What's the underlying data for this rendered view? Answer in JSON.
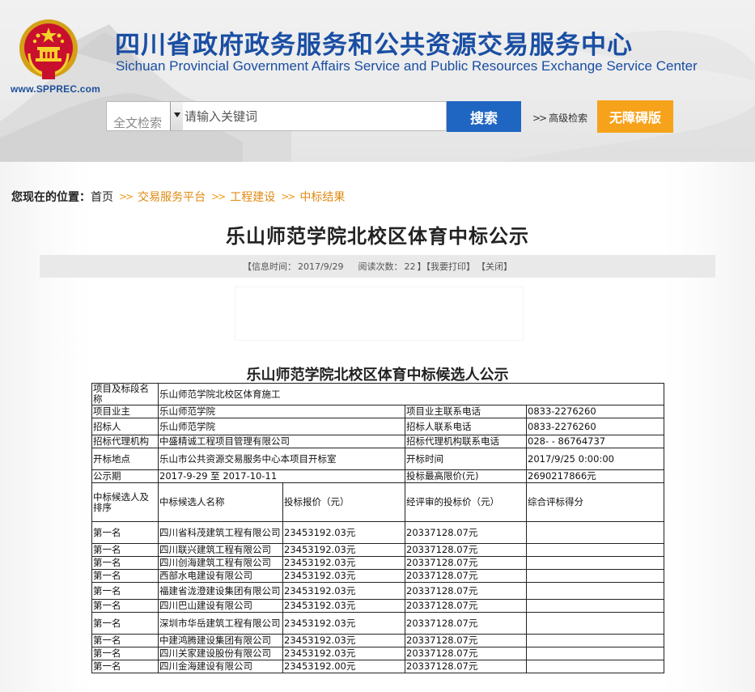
{
  "header": {
    "site_url": "www.SPPREC.com",
    "title_cn": "四川省政府政务服务和公共资源交易服务中心",
    "title_en": "Sichuan Provincial Government Affairs Service and Public Resources Exchange Service Center",
    "search": {
      "scope_selected": "全文检索",
      "placeholder": "请输入关键词",
      "button_label": "搜索"
    },
    "advanced_search_label": "高级检索",
    "accessibility_label": "无障碍版",
    "accent_blue": "#1f66c2",
    "accent_orange": "#f7a21b"
  },
  "breadcrumb": {
    "lead": "您现在的位置：",
    "items": [
      "首页",
      "交易服务平台",
      "工程建设",
      "中标结果"
    ]
  },
  "article": {
    "title": "乐山师范学院北校区体育中标公示",
    "info": {
      "time_label": "【信息时间：",
      "time_value": "2017/9/29",
      "views_label": "阅读次数：",
      "views_value": "22",
      "print_label": "】【我要打印】",
      "close_label": "【关闭】"
    },
    "notice_title": "乐山师范学院北校区体育中标候选人公示"
  },
  "table": {
    "project_label": "项目及标段名称",
    "project_value": "乐山师范学院北校区体育施工",
    "owner_label": "项目业主",
    "owner_value": "乐山师范学院",
    "owner_phone_label": "项目业主联系电话",
    "owner_phone_value": "0833-2276260",
    "tenderer_label": "招标人",
    "tenderer_value": "乐山师范学院",
    "tenderer_phone_label": "招标人联系电话",
    "tenderer_phone_value": "0833-2276260",
    "agency_label": "招标代理机构",
    "agency_value": "中盛精诚工程项目管理有限公司",
    "agency_phone_label": "招标代理机构联系电话",
    "agency_phone_value": "028- - 86764737",
    "location_label": "开标地点",
    "location_value": "乐山市公共资源交易服务中心本项目开标室",
    "open_time_label": "开标时间",
    "open_time_value": "2017/9/25 0:00:00",
    "period_label": "公示期",
    "period_value": "2017-9-29 至 2017-10-11",
    "max_price_label": "投标最高限价(元)",
    "max_price_value": "26902178​66元",
    "headers": [
      "中标候选人及排序",
      "中标候选人名称",
      "投标报价（元）",
      "经评审的投标价（元）",
      "综合评标得分"
    ],
    "candidates": [
      {
        "rank": "第一名",
        "name": "四川省科茂建筑工程有限公司",
        "bid": "23453192.03元",
        "reviewed": "20337128.07元",
        "score": ""
      },
      {
        "rank": "第一名",
        "name": "四川联兴建筑工程有限公司",
        "bid": "23453192.03元",
        "reviewed": "20337128.07元",
        "score": ""
      },
      {
        "rank": "第一名",
        "name": "四川创海建筑工程有限公司",
        "bid": "23453192.03元",
        "reviewed": "20337128.07元",
        "score": ""
      },
      {
        "rank": "第一名",
        "name": "西部水电建设有限公司",
        "bid": "23453192.03元",
        "reviewed": "20337128.07元",
        "score": ""
      },
      {
        "rank": "第一名",
        "name": "福建省泷澄建设集团有限公司",
        "bid": "23453192.03元",
        "reviewed": "20337128.07元",
        "score": ""
      },
      {
        "rank": "第一名",
        "name": "四川巴山建设有限公司",
        "bid": "23453192.03元",
        "reviewed": "20337128.07元",
        "score": ""
      },
      {
        "rank": "第一名",
        "name": "深圳市华岳建筑工程有限公司",
        "bid": "23453192.03元",
        "reviewed": "20337128.07元",
        "score": ""
      },
      {
        "rank": "第一名",
        "name": "中建鸿腾建设集团有限公司",
        "bid": "23453192.03元",
        "reviewed": "20337128.07元",
        "score": ""
      },
      {
        "rank": "第一名",
        "name": "四川关家建设股份有限公司",
        "bid": "23453192.03元",
        "reviewed": "20337128.07元",
        "score": ""
      },
      {
        "rank": "第一名",
        "name": "四川金海建设有限公司",
        "bid": "23453192.00元",
        "reviewed": "20337128.07元",
        "score": ""
      }
    ]
  }
}
